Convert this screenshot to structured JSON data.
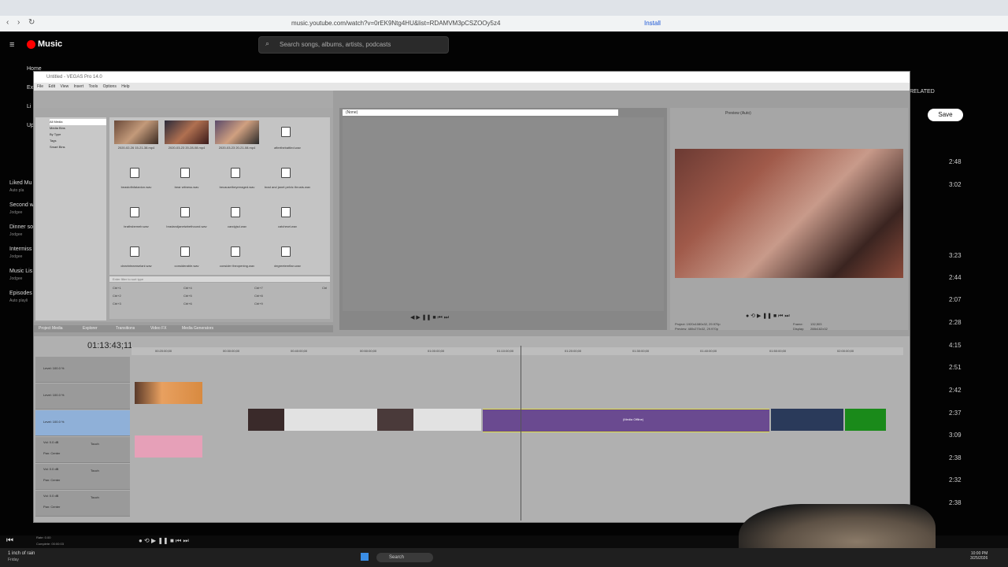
{
  "browser": {
    "url": "music.youtube.com/watch?v=0rEK9Ntg4HU&list=RDAMVM3pCSZOOy5z4",
    "install_label": "Install"
  },
  "ytmusic": {
    "logo": "Music",
    "search_placeholder": "Search songs, albums, artists, podcasts",
    "sidebar": [
      {
        "label": "Home"
      },
      {
        "label": "Ex"
      },
      {
        "label": "Li"
      },
      {
        "label": "Up"
      }
    ],
    "playlists": [
      {
        "title": "Liked Mu",
        "sub": "Auto pla"
      },
      {
        "title": "Second w",
        "sub": "Jodgee"
      },
      {
        "title": "Dinner so",
        "sub": "Jodgee"
      },
      {
        "title": "Intermiss",
        "sub": "Jodgee"
      },
      {
        "title": "Music Lis",
        "sub": "Jodgee"
      },
      {
        "title": "Episodes",
        "sub": "Auto playli"
      }
    ],
    "related_label": "RELATED",
    "save_label": "Save",
    "durations": [
      "2:48",
      "3:02",
      "3:23",
      "2:44",
      "2:07",
      "2:28",
      "4:15",
      "2:51",
      "2:42",
      "2:37",
      "3:09",
      "2:38",
      "2:32",
      "2:38"
    ]
  },
  "vegas": {
    "title": "Untitled - VEGAS Pro 14.0",
    "menu": [
      "File",
      "Edit",
      "View",
      "Insert",
      "Tools",
      "Options",
      "Help"
    ],
    "tree": [
      "All Media",
      "Media Bins",
      "By Type",
      "Tags",
      "Smart Bins"
    ],
    "media_files": [
      "2020-02-26 15-21-38.mp4",
      "2020-03-23 20-28-08.mp4",
      "2020-03-23 20-21-08.mp4",
      "afterthebattled.wav",
      "beastofinfatanion.wav",
      "bear witness.wav",
      "becausetheyreraged.wav",
      "brad and janet pelvic thrusts.wav",
      "brathsbemeb.wav",
      "bradandjanetwbethound.wav",
      "candyjsd.wav",
      "catchewt.wav",
      "clearinteamselani.wav",
      "considerable.wav",
      "consider theopening.wav",
      "degreetemflan.wav"
    ],
    "search_hint": "Enter filter to sort type",
    "keys": [
      "Ctrl+1",
      "Ctrl+4",
      "Ctrl+7",
      "Ctrl",
      "Ctrl+2",
      "Ctrl+5",
      "Ctrl+8",
      "Ctrl+3",
      "Ctrl+6",
      "Ctrl+9"
    ],
    "panel_tabs": [
      "Project Media",
      "Explorer",
      "Transitions",
      "Video FX",
      "Media Generators"
    ],
    "trimmer_label": "(None)",
    "preview_mode": "Preview (Auto)",
    "project_info": "Project: 1920x1080x32, 29.970p",
    "preview_info": "Preview: 480x270x32, 29.970p",
    "frame_label": "Frame:",
    "frame_value": "132,503",
    "display_label": "Display:",
    "display_value": "288x162x32",
    "timecode": "01:13:43;11",
    "ruler_marks": [
      "00:20:00;00",
      "00:30:00;00",
      "00:40:00;00",
      "00:50:00;00",
      "01:00:00;00",
      "01:10:00;00",
      "01:20:00;00",
      "01:30:00;00",
      "01:40:00;00",
      "01:50:00;00",
      "02:00:00;00"
    ],
    "tracks": [
      {
        "num": "1",
        "level": "Level: 100.0 %"
      },
      {
        "num": "2",
        "level": "Level: 100.0 %"
      },
      {
        "num": "3",
        "level": "Level: 100.0 %"
      },
      {
        "num": "4",
        "vol": "Vol: 0.0 dB",
        "pan": "Pan: Center",
        "mode": "Touch"
      },
      {
        "num": "5",
        "vol": "Vol: 0.0 dB",
        "pan": "Pan: Center",
        "mode": "Touch"
      },
      {
        "num": "6",
        "vol": "Vol: 0.0 dB",
        "pan": "Pan: Center",
        "mode": "Touch"
      }
    ],
    "media_offline_label": "(Media Offline)",
    "rate_label": "Rate: 0.00",
    "complete_label": "Complete: 00:00:03"
  },
  "taskbar": {
    "weather": "1 inch of rain",
    "weather_day": "Friday",
    "search_label": "Search",
    "time": "10:00 PM",
    "date": "3/25/2026"
  }
}
